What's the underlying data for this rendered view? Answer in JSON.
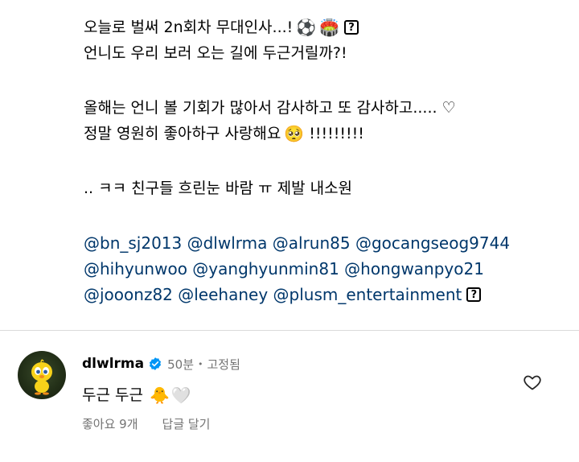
{
  "caption": {
    "line1": "오늘로 벌써 2n회차 무대인사...!",
    "line1_emoji1": "⚽",
    "line1_emoji2": "🏟️",
    "line1_box": "?",
    "line2": "언니도 우리 보러 오는 길에 두근거릴까?!",
    "line3": "올해는 언니 볼 기회가 많아서 감사하고 또 감사하고..... ♡",
    "line4": "정말 영원히 좋아하구 사랑해요",
    "line4_emoji": "🥺",
    "line4_tail": "!!!!!!!!!",
    "line5": ".. ㅋㅋ 친구들 흐린눈 바람 ㅠ 제발 내소원",
    "mentions": [
      [
        "@bn_sj2013",
        "@dlwlrma",
        "@alrun85",
        "@gocangseog9744"
      ],
      [
        "@hihyunwoo",
        "@yanghyunmin81",
        "@hongwanpyo21"
      ],
      [
        "@jooonz82",
        "@leehaney",
        "@plusm_entertainment"
      ]
    ],
    "mentions_box": "?"
  },
  "comment": {
    "username": "dlwlrma",
    "verified_icon": "verified-badge-icon",
    "time": "50분",
    "separator": "•",
    "pinned": "고정됨",
    "text": "두근 두근",
    "emoji1": "🐥",
    "emoji2": "🤍",
    "likes": "좋아요 9개",
    "reply": "답글 달기",
    "like_icon": "heart-icon"
  },
  "colors": {
    "mention": "#00376b",
    "meta": "#737373",
    "verified": "#0095f6",
    "divider": "#dbdbdb"
  }
}
